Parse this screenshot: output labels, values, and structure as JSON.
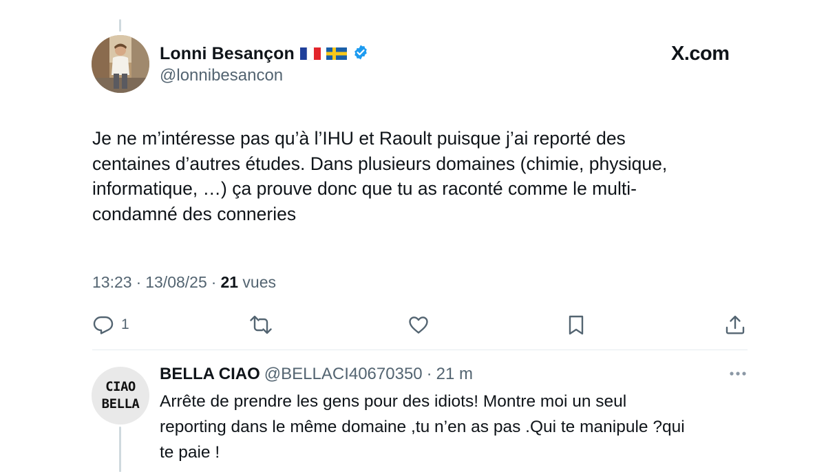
{
  "brand": "X.com",
  "tweet": {
    "author_name": "Lonni Besançon",
    "handle": "@lonnibesancon",
    "verified": true,
    "flags": [
      "france-flag",
      "sweden-flag"
    ],
    "text_lines": [
      "Je ne m’intéresse pas qu’à l’IHU et Raoult puisque j’ai reporté des",
      "centaines d’autres études. Dans plusieurs domaines (chimie, physique,",
      "informatique, …) ça prouve donc que tu as raconté comme le multi-",
      "condamné des conneries"
    ],
    "time": "13:23",
    "date": "13/08/25",
    "views_count": "21",
    "views_label": "vues",
    "reply_count": "1"
  },
  "reply": {
    "author_name": "BELLA CIAO",
    "handle": "@BELLACI40670350",
    "time_ago": "21 m",
    "avatar_text": [
      "CIAO",
      "BELLA"
    ],
    "text_lines": [
      "Arrête de prendre les gens pour des idiots! Montre moi un seul",
      "reporting dans le même domaine ,tu n’en as pas .Qui te manipule ?qui",
      "te paie !"
    ]
  },
  "colors": {
    "text": "#0f1419",
    "secondary": "#536471",
    "verified": "#1d9bf0",
    "divider": "#e6ecf0"
  },
  "icons": [
    "reply-icon",
    "retweet-icon",
    "like-icon",
    "bookmark-icon",
    "share-icon",
    "more-icon",
    "verified-badge-icon"
  ]
}
